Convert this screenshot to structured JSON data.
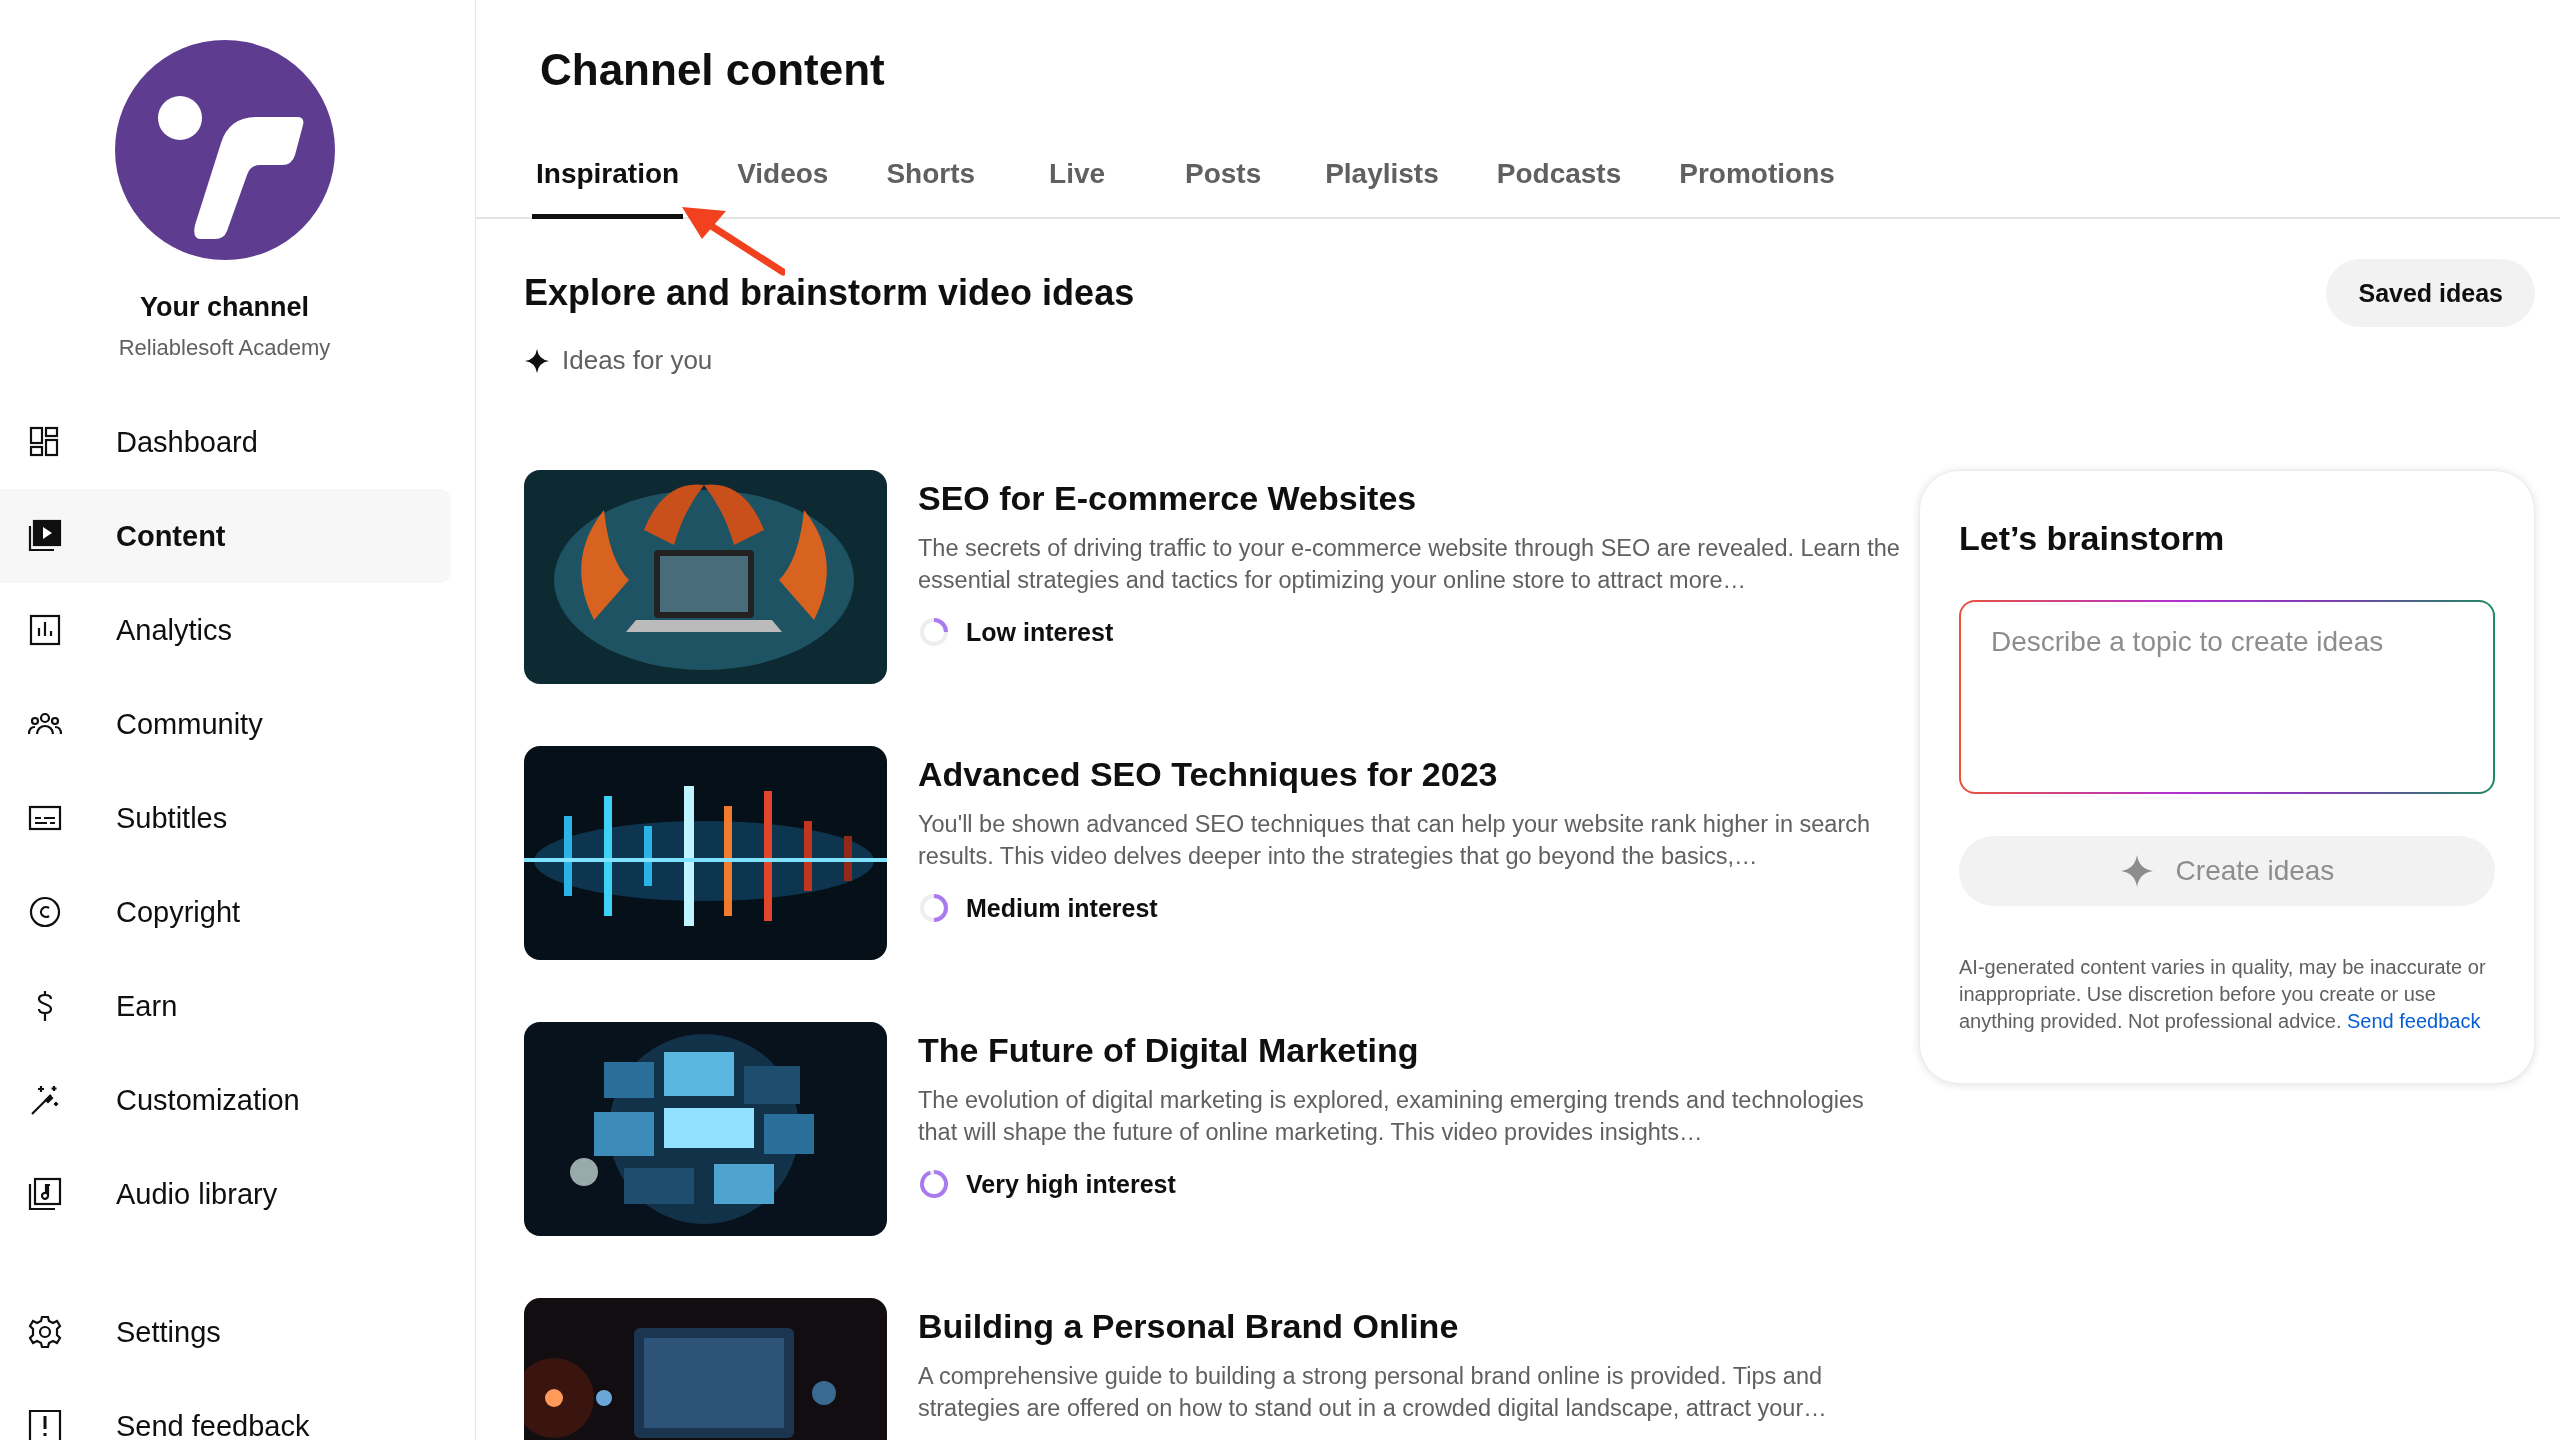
{
  "sidebar": {
    "channel": {
      "title": "Your channel",
      "name": "Reliablesoft Academy"
    },
    "items": [
      {
        "label": "Dashboard",
        "selected": false
      },
      {
        "label": "Content",
        "selected": true
      },
      {
        "label": "Analytics",
        "selected": false
      },
      {
        "label": "Community",
        "selected": false
      },
      {
        "label": "Subtitles",
        "selected": false
      },
      {
        "label": "Copyright",
        "selected": false
      },
      {
        "label": "Earn",
        "selected": false
      },
      {
        "label": "Customization",
        "selected": false
      },
      {
        "label": "Audio library",
        "selected": false
      }
    ],
    "footer_items": [
      {
        "label": "Settings"
      },
      {
        "label": "Send feedback"
      }
    ]
  },
  "header": {
    "title": "Channel content"
  },
  "tabs": [
    {
      "label": "Inspiration",
      "selected": true
    },
    {
      "label": "Videos",
      "selected": false
    },
    {
      "label": "Shorts",
      "selected": false
    },
    {
      "label": "Live",
      "selected": false
    },
    {
      "label": "Posts",
      "selected": false
    },
    {
      "label": "Playlists",
      "selected": false
    },
    {
      "label": "Podcasts",
      "selected": false
    },
    {
      "label": "Promotions",
      "selected": false
    }
  ],
  "section": {
    "title": "Explore and brainstorm video ideas",
    "subtitle": "Ideas for you",
    "saved_button": "Saved ideas"
  },
  "ideas": [
    {
      "title": "SEO for E-commerce Websites",
      "description": "The secrets of driving traffic to your e-commerce website through SEO are revealed. Learn the essential strategies and tactics for optimizing your online store to attract more…",
      "interest": {
        "label": "Low interest",
        "kind": "low"
      }
    },
    {
      "title": "Advanced SEO Techniques for 2023",
      "description": "You'll be shown advanced SEO techniques that can help your website rank higher in search results. This video delves deeper into the strategies that go beyond the basics,…",
      "interest": {
        "label": "Medium interest",
        "kind": "medium"
      }
    },
    {
      "title": "The Future of Digital Marketing",
      "description": "The evolution of digital marketing is explored, examining emerging trends and technologies that will shape the future of online marketing. This video provides insights…",
      "interest": {
        "label": "Very high interest",
        "kind": "very_high"
      }
    },
    {
      "title": "Building a Personal Brand Online",
      "description": "A comprehensive guide to building a strong personal brand online is provided. Tips and strategies are offered on how to stand out in a crowded digital landscape, attract your…"
    }
  ],
  "brainstorm": {
    "title": "Let’s brainstorm",
    "placeholder": "Describe a topic to create ideas",
    "button": "Create ideas",
    "button_disabled": true,
    "disclaimer": "AI-generated content varies in quality, may be inaccurate or inappropriate. Use discretion before you create or use anything provided. Not professional advice.",
    "link": "Send feedback"
  }
}
